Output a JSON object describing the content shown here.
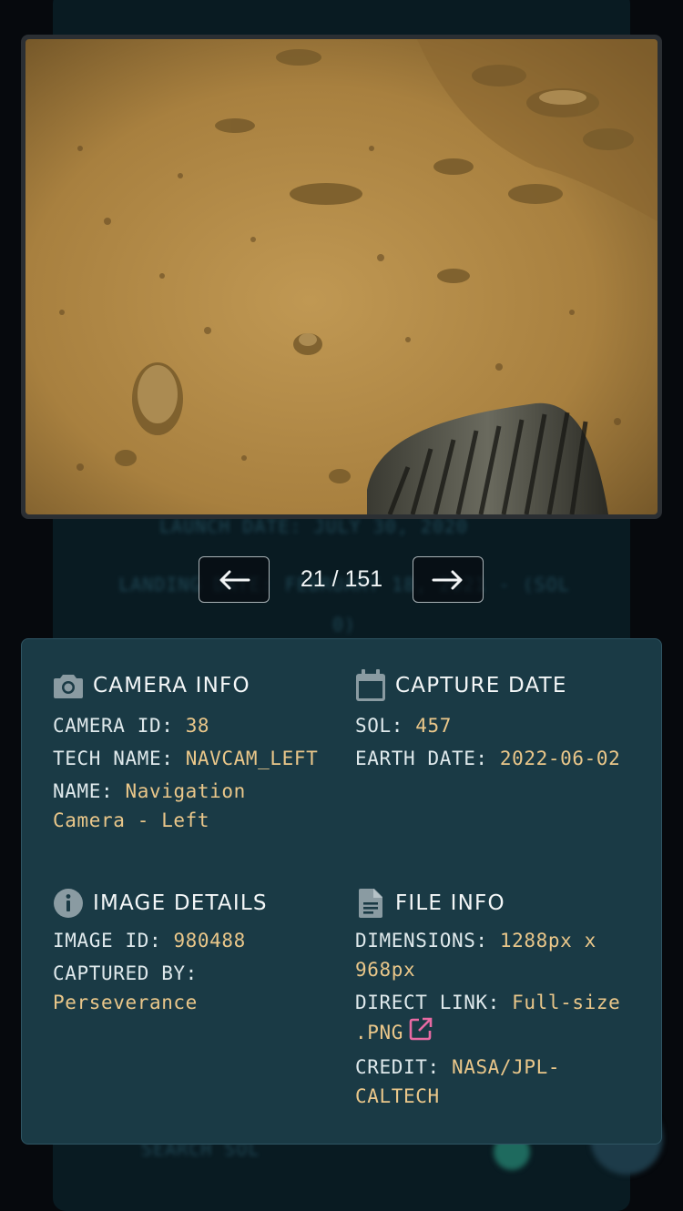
{
  "gallery": {
    "counter": "21 / 151",
    "prev_icon": "arrow-left-icon",
    "next_icon": "arrow-right-icon"
  },
  "background": {
    "line1": "LAUNCH DATE: JULY 30, 2020",
    "line2": "LANDING DATE: FEBRUARY 18, 2021 - (SOL 0)",
    "line3": "SEARCH SOL"
  },
  "camera_info": {
    "title": "CAMERA INFO",
    "icon": "camera-icon",
    "id_label": "CAMERA ID: ",
    "id_value": "38",
    "tech_label": "TECH NAME: ",
    "tech_value": "NAVCAM_LEFT",
    "name_label": "NAME: ",
    "name_value": "Navigation Camera - Left"
  },
  "capture_date": {
    "title": "CAPTURE DATE",
    "icon": "calendar-icon",
    "sol_label": "SOL: ",
    "sol_value": "457",
    "earth_label": "EARTH DATE: ",
    "earth_value": "2022-06-02"
  },
  "image_details": {
    "title": "IMAGE DETAILS",
    "icon": "info-icon",
    "id_label": "IMAGE ID: ",
    "id_value": "980488",
    "by_label": "CAPTURED BY: ",
    "by_value": "Perseverance"
  },
  "file_info": {
    "title": "FILE INFO",
    "icon": "document-icon",
    "dim_label": "DIMENSIONS: ",
    "dim_value": "1288px x 968px",
    "link_label": "DIRECT LINK: ",
    "link_value": "Full-size .PNG",
    "link_icon": "external-link-icon",
    "credit_label": "CREDIT: ",
    "credit_value": "NASA/JPL-CALTECH"
  },
  "colors": {
    "panel_bg": "#1a3a45",
    "value_accent": "#eac78a",
    "link_icon": "#e86aa3"
  }
}
